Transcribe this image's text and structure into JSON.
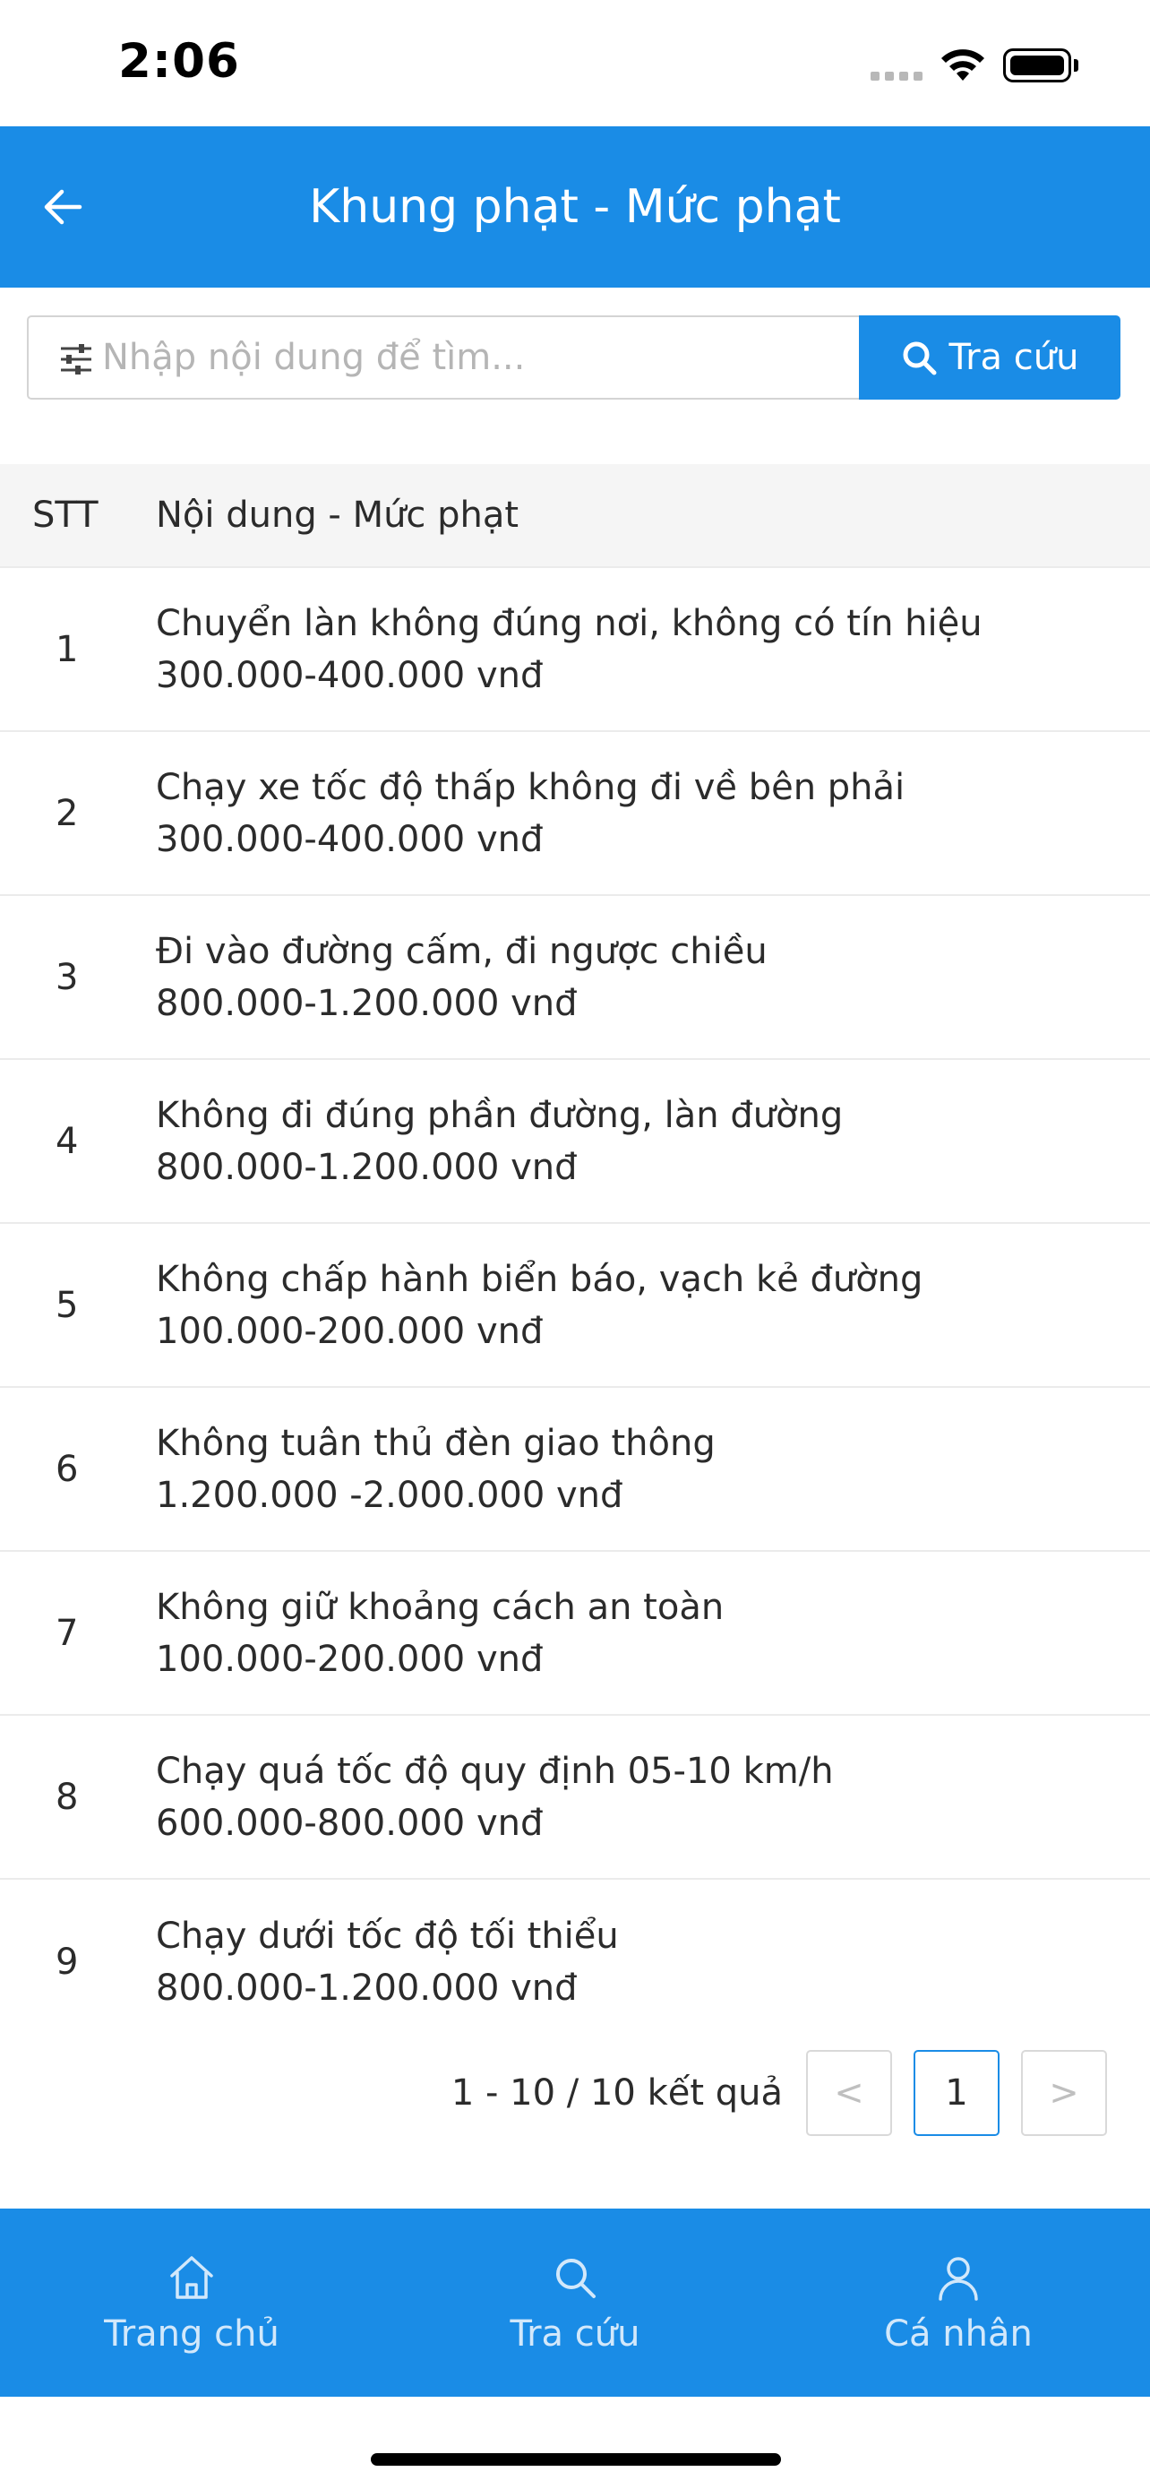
{
  "status_bar": {
    "time": "2:06",
    "icons": [
      "signal-icon",
      "wifi-icon",
      "battery-icon"
    ]
  },
  "header": {
    "title": "Khung phạt - Mức phạt",
    "back_icon": "arrow-left-icon",
    "background": "#1a8ce6"
  },
  "search": {
    "placeholder": "Nhập nội dung để tìm...",
    "value": "",
    "button_label": "Tra cứu",
    "filter_icon": "sliders-icon",
    "button_icon": "search-icon"
  },
  "table": {
    "headers": {
      "stt": "STT",
      "content": "Nội dung - Mức phạt"
    },
    "rows": [
      {
        "stt": "1",
        "title": "Chuyển làn không đúng nơi, không có tín hiệu",
        "fine": "300.000-400.000 vnđ"
      },
      {
        "stt": "2",
        "title": "Chạy xe tốc độ thấp không đi về bên phải",
        "fine": "300.000-400.000 vnđ"
      },
      {
        "stt": "3",
        "title": "Đi vào đường cấm, đi ngược chiều",
        "fine": "800.000-1.200.000 vnđ"
      },
      {
        "stt": "4",
        "title": "Không đi đúng phần đường, làn đường",
        "fine": "800.000-1.200.000 vnđ"
      },
      {
        "stt": "5",
        "title": "Không chấp hành biển báo, vạch kẻ đường",
        "fine": "100.000-200.000 vnđ"
      },
      {
        "stt": "6",
        "title": "Không tuân thủ đèn giao thông",
        "fine": "1.200.000 -2.000.000 vnđ"
      },
      {
        "stt": "7",
        "title": "Không giữ khoảng cách an toàn",
        "fine": "100.000-200.000 vnđ"
      },
      {
        "stt": "8",
        "title": "Chạy quá tốc độ quy định 05-10 km/h",
        "fine": "600.000-800.000 vnđ"
      },
      {
        "stt": "9",
        "title": "Chạy dưới tốc độ tối thiểu",
        "fine": "800.000-1.200.000 vnđ"
      }
    ]
  },
  "pagination": {
    "info": "1 - 10 / 10 kết quả",
    "prev": "<",
    "current": "1",
    "next": ">"
  },
  "bottom_nav": {
    "items": [
      {
        "label": "Trang chủ",
        "icon": "home-icon"
      },
      {
        "label": "Tra cứu",
        "icon": "search-icon"
      },
      {
        "label": "Cá nhân",
        "icon": "user-icon"
      }
    ]
  },
  "colors": {
    "accent": "#1a8ce6",
    "nav_label": "#d2e8fb",
    "text": "#2b2b2b"
  }
}
